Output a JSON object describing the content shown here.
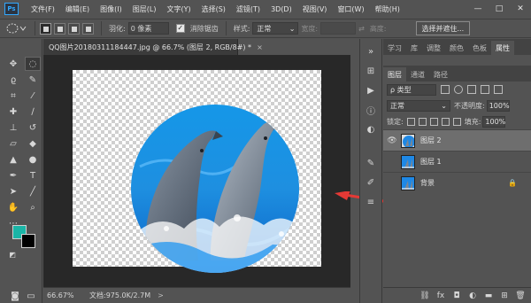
{
  "app": {
    "logo": "Ps"
  },
  "menu": [
    "文件(F)",
    "编辑(E)",
    "图像(I)",
    "图层(L)",
    "文字(Y)",
    "选择(S)",
    "滤镜(T)",
    "3D(D)",
    "视图(V)",
    "窗口(W)",
    "帮助(H)"
  ],
  "window_controls": {
    "minimize": "—",
    "maximize": "□",
    "close": "✕"
  },
  "options": {
    "feather_label": "羽化:",
    "feather_value": "0 像素",
    "antialias_label": "消除锯齿",
    "antialias_checked": true,
    "style_label": "样式:",
    "style_value": "正常",
    "width_label": "宽度:",
    "height_label": "高度:",
    "select_mask_button": "选择并遮住..."
  },
  "colors": {
    "foreground": "#1ab5a6",
    "background": "#000000",
    "arrow": "#e53935",
    "accent": "#31a8ff"
  },
  "document": {
    "tab_title": "QQ图片20180311184447.jpg @ 66.7% (图层 2, RGB/8#) *",
    "tab_close": "×"
  },
  "status": {
    "zoom": "66.67%",
    "doc_info": "文档:975.0K/2.7M",
    "arrow": ">"
  },
  "panels": {
    "top_tabs": [
      "学习",
      "库",
      "调整",
      "颜色",
      "色板",
      "属性"
    ],
    "top_active": "属性",
    "layer_tabs": [
      "图层",
      "通道",
      "路径"
    ],
    "layer_active": "图层",
    "filter_kind": "ρ 类型",
    "blend_mode": "正常",
    "opacity_label": "不透明度:",
    "opacity_value": "100%",
    "lock_label": "锁定:",
    "fill_label": "填充:",
    "fill_value": "100%"
  },
  "layers": [
    {
      "name": "图层 2",
      "visible": true,
      "selected": true,
      "locked": false
    },
    {
      "name": "图层 1",
      "visible": false,
      "selected": false,
      "locked": false
    },
    {
      "name": "背景",
      "visible": false,
      "selected": false,
      "locked": true
    }
  ],
  "layer_footer_icons": [
    "link-icon",
    "fx-icon",
    "mask-icon",
    "adjustment-icon",
    "folder-icon",
    "new-layer-icon",
    "trash-icon"
  ],
  "footer_glyphs": {
    "fx": "fx"
  }
}
